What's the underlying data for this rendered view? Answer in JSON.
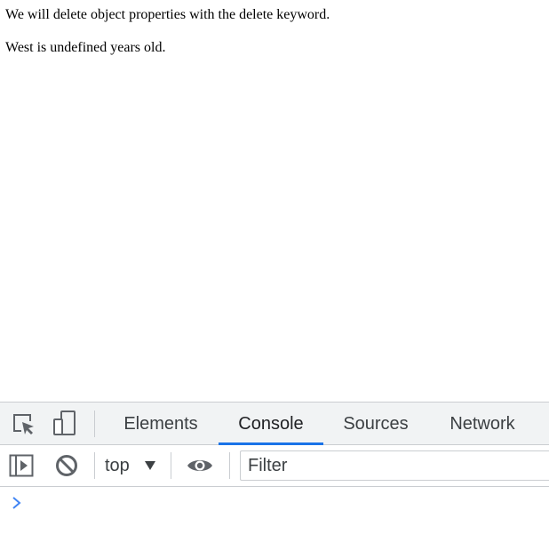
{
  "page": {
    "lines": [
      "We will delete object properties with the delete keyword.",
      "West is undefined years old."
    ]
  },
  "devtools": {
    "tabs": [
      {
        "label": "Elements",
        "active": false
      },
      {
        "label": "Console",
        "active": true
      },
      {
        "label": "Sources",
        "active": false
      },
      {
        "label": "Network",
        "active": false
      }
    ],
    "toolbar": {
      "context": "top",
      "filter_placeholder": "Filter"
    },
    "icons": {
      "inspect": "inspect-element-icon",
      "device": "device-toolbar-icon",
      "sidebar": "show-console-sidebar-icon",
      "clear": "clear-console-icon",
      "context_dropdown": "dropdown-arrow-icon",
      "live_expression": "eye-icon",
      "prompt": "chevron-right-icon"
    },
    "colors": {
      "accent": "#1a73e8",
      "icon": "#5f6368",
      "prompt": "#4285f4",
      "tabbar_bg": "#f1f3f4"
    }
  }
}
